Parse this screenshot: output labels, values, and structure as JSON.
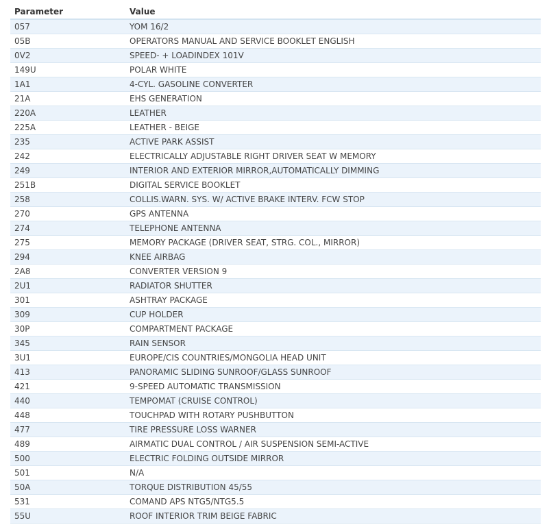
{
  "table": {
    "headers": {
      "parameter": "Parameter",
      "value": "Value"
    },
    "rows": [
      {
        "parameter": "057",
        "value": "YOM 16/2"
      },
      {
        "parameter": "05B",
        "value": "OPERATORS MANUAL AND SERVICE BOOKLET ENGLISH"
      },
      {
        "parameter": "0V2",
        "value": "SPEED- + LOADINDEX 101V"
      },
      {
        "parameter": "149U",
        "value": "POLAR WHITE"
      },
      {
        "parameter": "1A1",
        "value": "4-CYL. GASOLINE CONVERTER"
      },
      {
        "parameter": "21A",
        "value": "EHS GENERATION"
      },
      {
        "parameter": "220A",
        "value": "LEATHER"
      },
      {
        "parameter": "225A",
        "value": "LEATHER - BEIGE"
      },
      {
        "parameter": "235",
        "value": "ACTIVE PARK ASSIST"
      },
      {
        "parameter": "242",
        "value": "ELECTRICALLY ADJUSTABLE RIGHT DRIVER SEAT W MEMORY"
      },
      {
        "parameter": "249",
        "value": "INTERIOR AND EXTERIOR MIRROR,AUTOMATICALLY DIMMING"
      },
      {
        "parameter": "251B",
        "value": "DIGITAL SERVICE BOOKLET"
      },
      {
        "parameter": "258",
        "value": "COLLIS.WARN. SYS. W/ ACTIVE BRAKE INTERV. FCW STOP"
      },
      {
        "parameter": "270",
        "value": "GPS ANTENNA"
      },
      {
        "parameter": "274",
        "value": "TELEPHONE ANTENNA"
      },
      {
        "parameter": "275",
        "value": "MEMORY PACKAGE (DRIVER SEAT, STRG. COL., MIRROR)"
      },
      {
        "parameter": "294",
        "value": "KNEE AIRBAG"
      },
      {
        "parameter": "2A8",
        "value": "CONVERTER VERSION 9"
      },
      {
        "parameter": "2U1",
        "value": "RADIATOR SHUTTER"
      },
      {
        "parameter": "301",
        "value": "ASHTRAY PACKAGE"
      },
      {
        "parameter": "309",
        "value": "CUP HOLDER"
      },
      {
        "parameter": "30P",
        "value": "COMPARTMENT PACKAGE"
      },
      {
        "parameter": "345",
        "value": "RAIN SENSOR"
      },
      {
        "parameter": "3U1",
        "value": "EUROPE/CIS COUNTRIES/MONGOLIA HEAD UNIT"
      },
      {
        "parameter": "413",
        "value": "PANORAMIC SLIDING SUNROOF/GLASS SUNROOF"
      },
      {
        "parameter": "421",
        "value": "9-SPEED AUTOMATIC TRANSMISSION"
      },
      {
        "parameter": "440",
        "value": "TEMPOMAT (CRUISE CONTROL)"
      },
      {
        "parameter": "448",
        "value": "TOUCHPAD WITH ROTARY PUSHBUTTON"
      },
      {
        "parameter": "477",
        "value": "TIRE PRESSURE LOSS WARNER"
      },
      {
        "parameter": "489",
        "value": "AIRMATIC DUAL CONTROL / AIR SUSPENSION SEMI-ACTIVE"
      },
      {
        "parameter": "500",
        "value": "ELECTRIC FOLDING OUTSIDE MIRROR"
      },
      {
        "parameter": "501",
        "value": "N/A"
      },
      {
        "parameter": "50A",
        "value": "TORQUE DISTRIBUTION 45/55"
      },
      {
        "parameter": "531",
        "value": "COMAND APS NTG5/NTG5.5"
      },
      {
        "parameter": "55U",
        "value": "ROOF INTERIOR TRIM BEIGE FABRIC"
      }
    ]
  },
  "colors": {
    "row_alt": "#ebf3fb",
    "border": "#d8e6f2"
  }
}
